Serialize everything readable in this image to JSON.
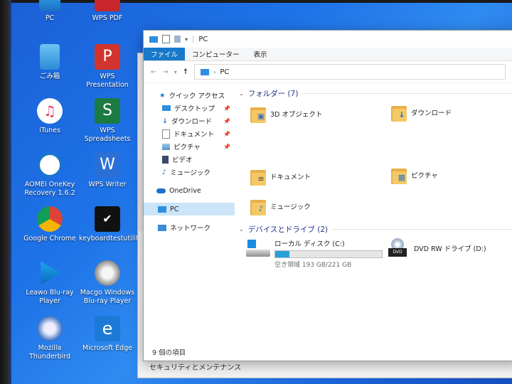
{
  "desktop": {
    "icons": [
      {
        "label": "PC"
      },
      {
        "label": "WPS PDF"
      },
      {
        "label": "ごみ箱"
      },
      {
        "label": "WPS Presentation"
      },
      {
        "label": "iTunes"
      },
      {
        "label": "WPS Spreadsheets"
      },
      {
        "label": "AOMEI OneKey Recovery 1.6.2"
      },
      {
        "label": "WPS Writer"
      },
      {
        "label": "Google Chrome"
      },
      {
        "label": "keyboardtestutility"
      },
      {
        "label": "Leawo Blu-ray Player"
      },
      {
        "label": "Macgo Windows Blu-ray Player"
      },
      {
        "label": "Mozilla Thunderbird"
      },
      {
        "label": "Microsoft Edge"
      }
    ]
  },
  "back_window": {
    "caption": "セキュリティとメンテナンス"
  },
  "explorer": {
    "title": "PC",
    "ribbon_tabs": [
      "ファイル",
      "コンピューター",
      "表示"
    ],
    "address": {
      "path": "PC"
    },
    "nav": {
      "quick_access": "クイック アクセス",
      "items": [
        "デスクトップ",
        "ダウンロード",
        "ドキュメント",
        "ピクチャ",
        "ビデオ",
        "ミュージック"
      ],
      "onedrive": "OneDrive",
      "pc": "PC",
      "network": "ネットワーク"
    },
    "folders_header": "フォルダー (7)",
    "folders": [
      "3D オブジェクト",
      "ダウンロード",
      "ドキュメント",
      "ピクチャ",
      "ミュージック"
    ],
    "devices_header": "デバイスとドライブ (2)",
    "drives": [
      {
        "name": "ローカル ディスク (C:)",
        "free": "空き領域 193 GB/221 GB",
        "used_fraction": 0.13
      },
      {
        "name": "DVD RW ドライブ (D:)"
      }
    ],
    "status": "9 個の項目"
  },
  "colors": {
    "accent": "#1979ca",
    "drive_fill": "#26a0da",
    "folder": "#f5c866"
  }
}
